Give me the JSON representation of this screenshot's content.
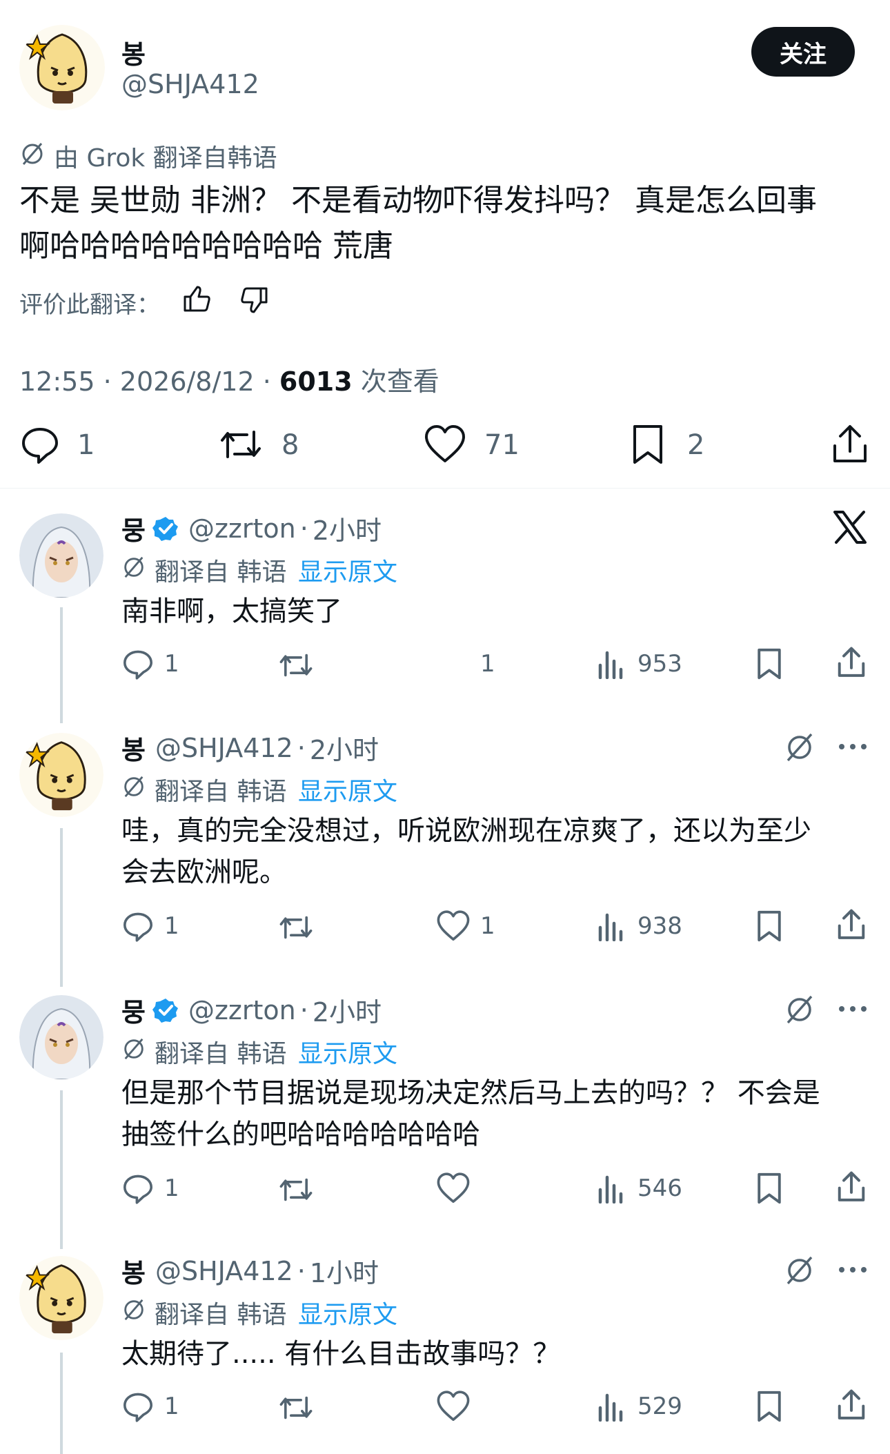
{
  "main_tweet": {
    "author_name": "봉",
    "author_handle": "@SHJA412",
    "follow_label": "关注",
    "translation_note": "由 Grok 翻译自韩语",
    "text_line1": "不是 吴世勋 非洲？ 不是看动物吓得发抖吗？ 真是怎么回事",
    "text_line2": "啊哈哈哈哈哈哈哈哈哈 荒唐",
    "rate_label": "评价此翻译：",
    "time": "12:55",
    "date": "2026/8/12",
    "views": "6013",
    "views_label": "次查看",
    "sep": "·",
    "replies": "1",
    "retweets": "8",
    "likes": "71",
    "bookmarks": "2"
  },
  "replies": [
    {
      "name": "뭉",
      "verified": true,
      "handle": "@zzrton",
      "time": "2小时",
      "translated_label": "翻译自 韩语",
      "show_original": "显示原文",
      "text_line1": "南非啊，太搞笑了",
      "text_line2": "",
      "replies": "1",
      "likes": "1",
      "views": "953"
    },
    {
      "name": "봉",
      "verified": false,
      "handle": "@SHJA412",
      "time": "2小时",
      "translated_label": "翻译自 韩语",
      "show_original": "显示原文",
      "text_line1": "哇，真的完全没想过，听说欧洲现在凉爽了，还以为至少",
      "text_line2": "会去欧洲呢。",
      "replies": "1",
      "likes": "1",
      "views": "938"
    },
    {
      "name": "뭉",
      "verified": true,
      "handle": "@zzrton",
      "time": "2小时",
      "translated_label": "翻译自 韩语",
      "show_original": "显示原文",
      "text_line1": "但是那个节目据说是现场决定然后马上去的吗？？ 不会是",
      "text_line2": "抽签什么的吧哈哈哈哈哈哈哈",
      "replies": "1",
      "likes": "",
      "views": "546"
    },
    {
      "name": "봉",
      "verified": false,
      "handle": "@SHJA412",
      "time": "1小时",
      "translated_label": "翻译自 韩语",
      "show_original": "显示原文",
      "text_line1": "太期待了..... 有什么目击故事吗？？",
      "text_line2": "",
      "replies": "1",
      "likes": "",
      "views": "529"
    }
  ],
  "colors": {
    "text": "#0f1419",
    "secondary": "#536471",
    "link": "#1d9bf0",
    "button": "#0f1419",
    "verified": "#1d9bf0"
  }
}
